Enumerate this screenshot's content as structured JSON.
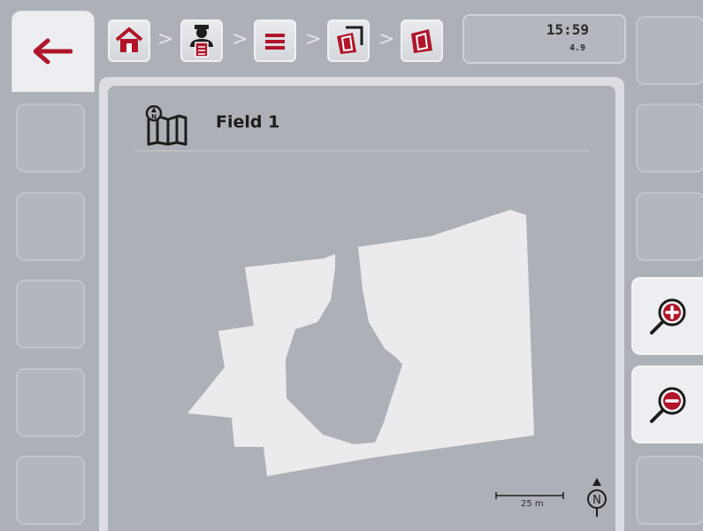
{
  "status": {
    "clock": "15:59",
    "version": "4.9"
  },
  "field": {
    "name": "Field 1"
  },
  "map": {
    "scale_label": "25 m",
    "north_label": "N"
  },
  "breadcrumb": [
    "home-icon",
    "operator-icon",
    "list-icon",
    "fields-icon",
    "field-icon"
  ],
  "colors": {
    "accent": "#b0152a",
    "field_fill": "#ebebed",
    "background": "#adb0b6"
  },
  "buttons": {
    "back": "arrow-left-icon",
    "zoom_in": "zoom-in-icon",
    "zoom_out": "zoom-out-icon"
  }
}
